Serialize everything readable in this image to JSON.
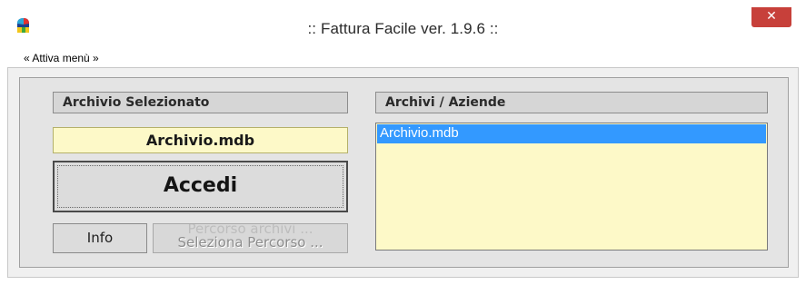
{
  "window": {
    "title": ":: Fattura Facile  ver. 1.9.6 ::",
    "close_glyph": "✕",
    "app_icon": "colorful-hat-icon"
  },
  "menu": {
    "toggle_label": "« Attiva menù »"
  },
  "left_panel": {
    "header": "Archivio Selezionato",
    "selected_archive": "Archivio.mdb",
    "accedi_label": "Accedi",
    "info_label": "Info",
    "path_button_ghost": "Percorso archivi ...",
    "path_button_label": "Seleziona Percorso ..."
  },
  "right_panel": {
    "header": "Archivi / Aziende",
    "items": [
      {
        "label": "Archivio.mdb",
        "selected": true
      }
    ]
  },
  "colors": {
    "selection": "#3399ff",
    "field_background": "#fdf9c8",
    "close_button": "#c7403a"
  }
}
